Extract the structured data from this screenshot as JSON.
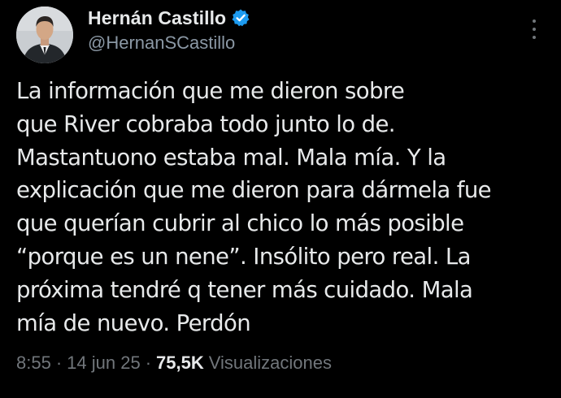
{
  "author": {
    "display_name": "Hernán Castillo",
    "handle": "@HernanSCastillo",
    "verified_icon": "verified-badge-icon",
    "verified_color": "#1d9bf0"
  },
  "tweet": {
    "text": "La información que me dieron sobre\nque River cobraba todo junto lo de.\nMastantuono estaba mal. Mala mía. Y la\nexplicación que me dieron para dármela fue\nque querían cubrir al chico lo más posible\n“porque es un nene”. Insólito pero real. La\npróxima tendré q tener más cuidado. Mala\nmía de nuevo. Perdón",
    "time": "8:55",
    "separator": "·",
    "date": "14 jun 25",
    "views_count": "75,5K",
    "views_label": "Visualizaciones"
  },
  "colors": {
    "background": "#000000",
    "text_primary": "#e7e9ea",
    "text_secondary": "#71767b",
    "handle": "#8b98a5"
  },
  "icons": {
    "more": "more-options-icon"
  }
}
